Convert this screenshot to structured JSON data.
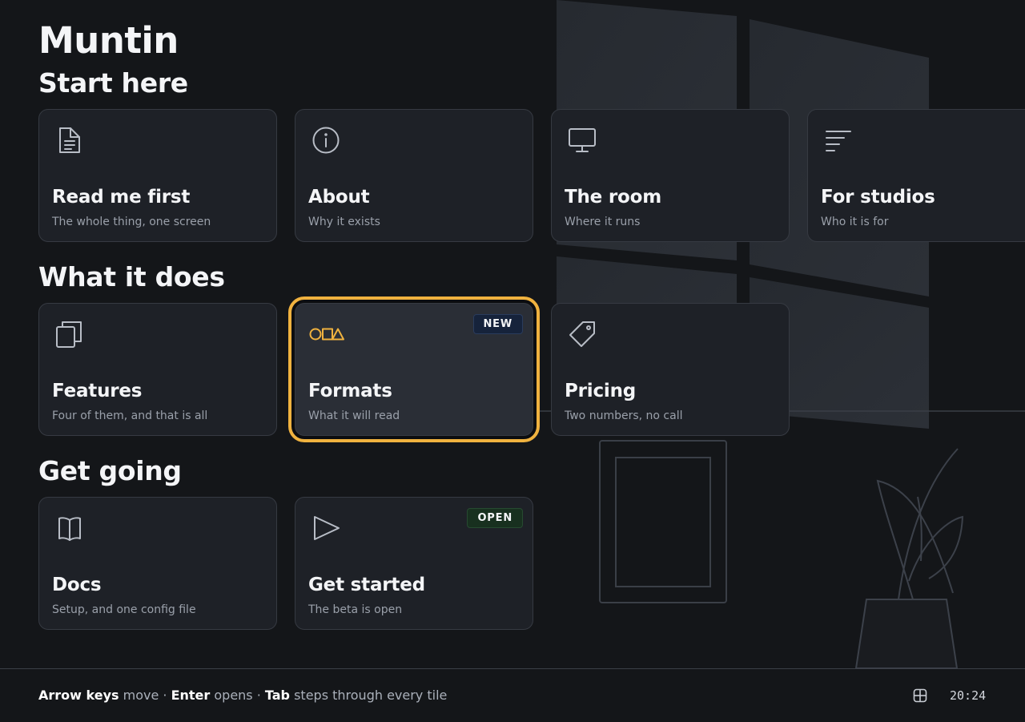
{
  "app": {
    "title": "Muntin"
  },
  "sections": [
    {
      "title": "Start here",
      "tiles": [
        {
          "icon": "document-icon",
          "title": "Read me first",
          "subtitle": "The whole thing, one screen"
        },
        {
          "icon": "info-icon",
          "title": "About",
          "subtitle": "Why it exists"
        },
        {
          "icon": "monitor-icon",
          "title": "The room",
          "subtitle": "Where it runs"
        },
        {
          "icon": "text-lines-icon",
          "title": "For studios",
          "subtitle": "Who it is for"
        }
      ]
    },
    {
      "title": "What it does",
      "tiles": [
        {
          "icon": "copy-icon",
          "title": "Features",
          "subtitle": "Four of them, and that is all"
        },
        {
          "icon": "shapes-icon",
          "title": "Formats",
          "subtitle": "What it will read",
          "badge": "NEW",
          "focused": true
        },
        {
          "icon": "tag-icon",
          "title": "Pricing",
          "subtitle": "Two numbers, no call"
        }
      ]
    },
    {
      "title": "Get going",
      "tiles": [
        {
          "icon": "book-icon",
          "title": "Docs",
          "subtitle": "Setup, and one config file"
        },
        {
          "icon": "play-icon",
          "title": "Get started",
          "subtitle": "The beta is open",
          "badge": "OPEN"
        }
      ]
    }
  ],
  "footer": {
    "hint": {
      "k1": "Arrow keys",
      "t1": " move · ",
      "k2": "Enter",
      "t2": " opens · ",
      "k3": "Tab",
      "t3": " steps through every tile"
    },
    "layout_icon": "layout-grid-icon",
    "time": "20:24"
  },
  "colors": {
    "background": "#141619",
    "tile": "#1e2127",
    "tile_focused": "#2a2e36",
    "focus_ring": "#f0b23f",
    "badge_new": "#16233b",
    "badge_open": "#18301f"
  }
}
